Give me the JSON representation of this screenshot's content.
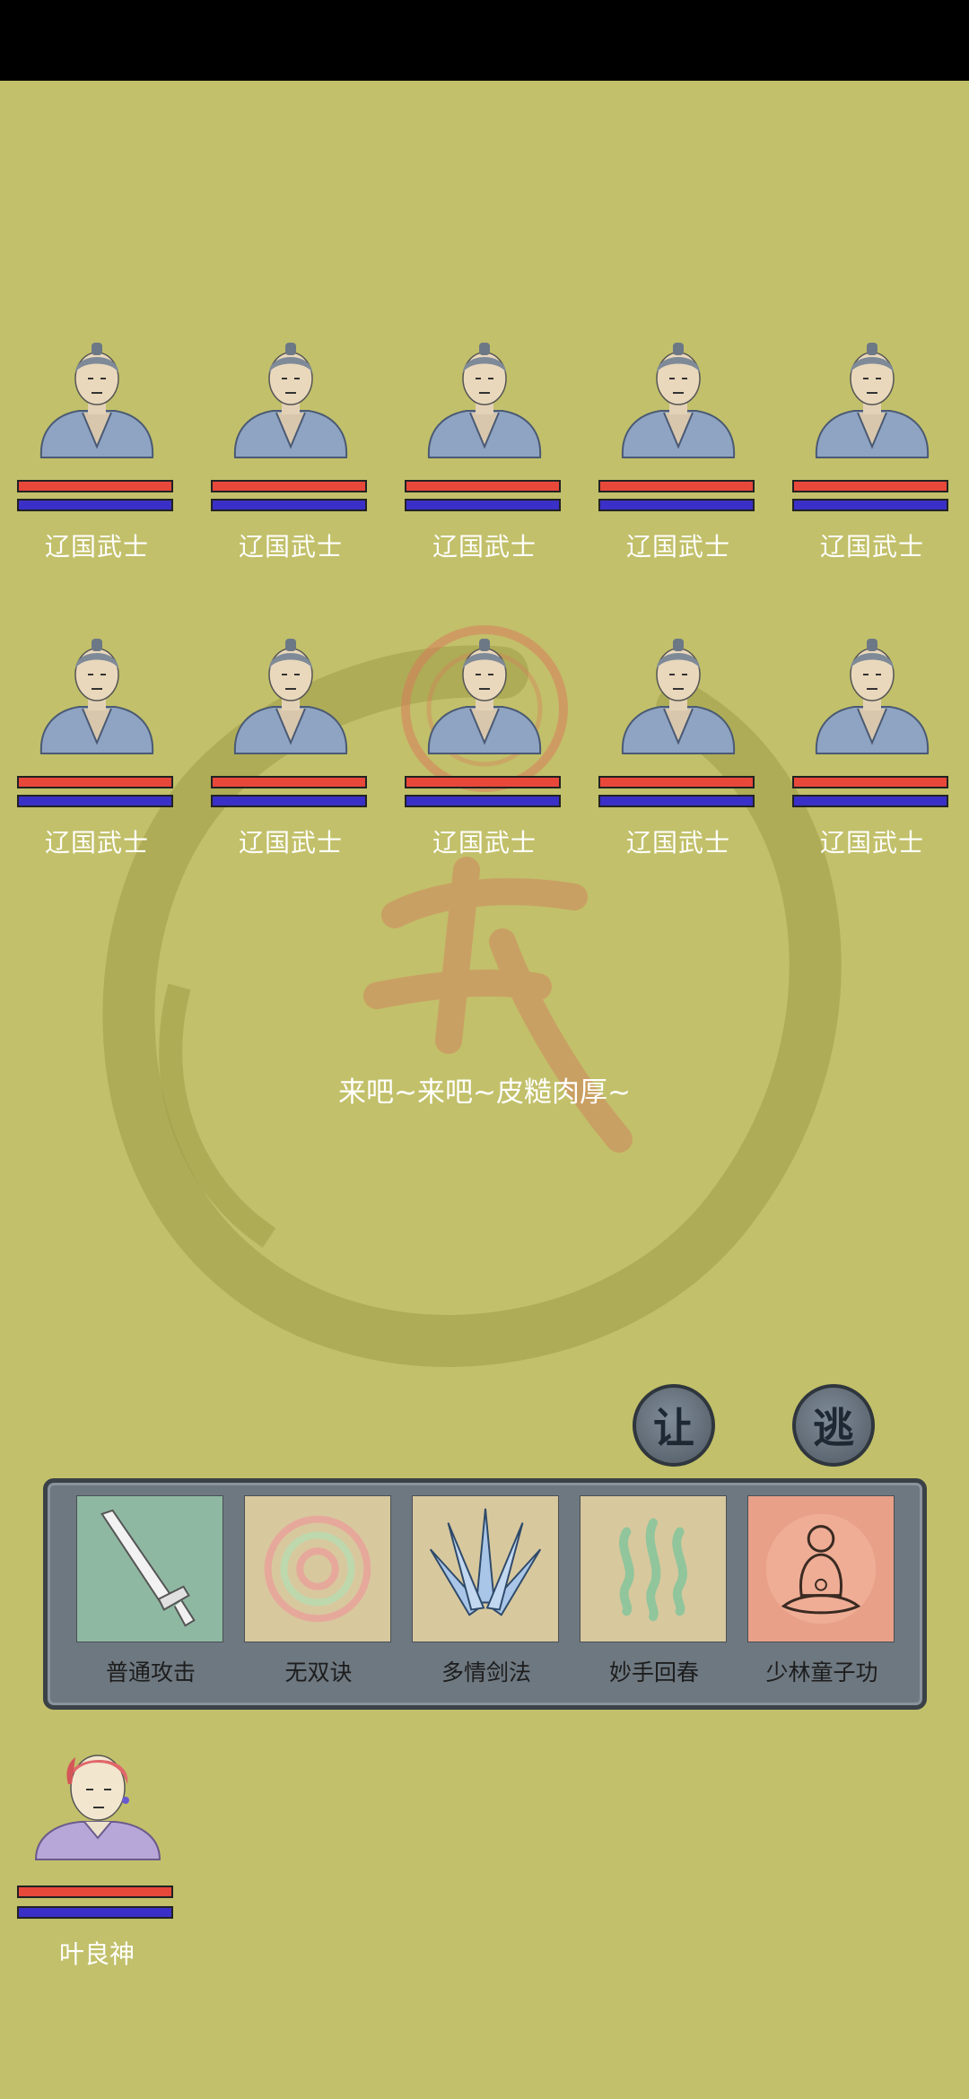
{
  "enemies": [
    {
      "name": "辽国武士"
    },
    {
      "name": "辽国武士"
    },
    {
      "name": "辽国武士"
    },
    {
      "name": "辽国武士"
    },
    {
      "name": "辽国武士"
    },
    {
      "name": "辽国武士"
    },
    {
      "name": "辽国武士"
    },
    {
      "name": "辽国武士"
    },
    {
      "name": "辽国武士"
    },
    {
      "name": "辽国武士"
    }
  ],
  "battle_message": "来吧~来吧~皮糙肉厚~",
  "actions": {
    "yield_label": "让",
    "flee_label": "逃"
  },
  "skills": [
    {
      "label": "普通攻击",
      "icon": "sword-icon"
    },
    {
      "label": "无双诀",
      "icon": "spiral-icon"
    },
    {
      "label": "多情剑法",
      "icon": "multi-sword-icon"
    },
    {
      "label": "妙手回春",
      "icon": "healing-waves-icon"
    },
    {
      "label": "少林童子功",
      "icon": "meditating-monk-icon"
    }
  ],
  "player": {
    "name": "叶良神"
  },
  "colors": {
    "background": "#c2c06a",
    "hp": "#e8483a",
    "mp": "#3a2fc7"
  }
}
